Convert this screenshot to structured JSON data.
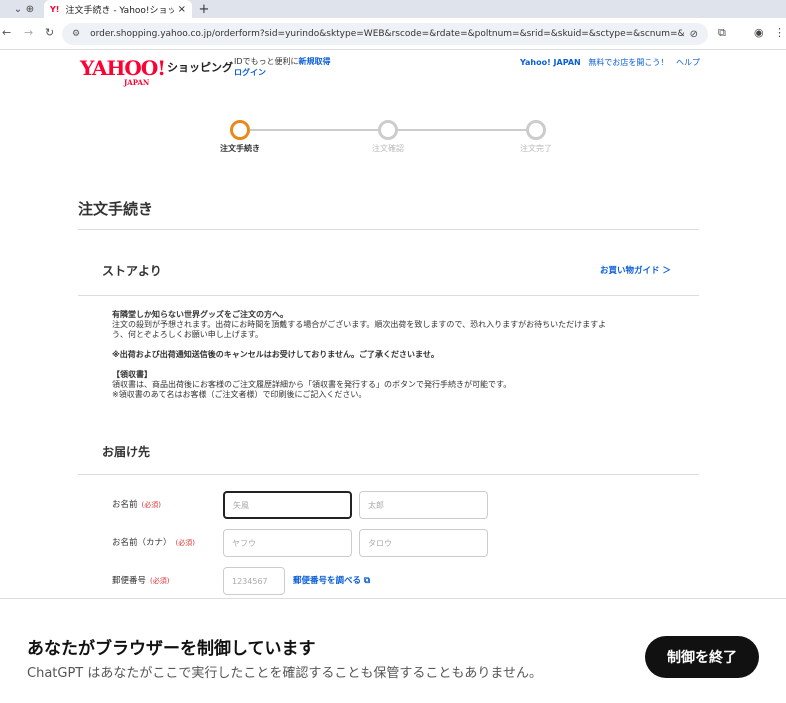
{
  "browser": {
    "pinned_tab_icon": "⊕",
    "active_tab": {
      "favicon": "Y!",
      "title": "注文手続き - Yahoo!ショッピ",
      "close": "×"
    },
    "new_tab": "+",
    "url": "order.shopping.yahoo.co.jp/orderform?sid=yurindo&sktype=WEB&rscode=&rdate=&poltnum=&srid=&skuid=&sctype=&scnum=&did=&sgid..."
  },
  "header": {
    "logo": "YAHOO!",
    "logo_sub": "JAPAN",
    "shopping": "ショッピング",
    "id_text": "IDでもっと便利に",
    "register": "新規取得",
    "login": "ログイン",
    "right_links": {
      "yahoo": "Yahoo! JAPAN",
      "open_store": "無料でお店を開こう！",
      "help": "ヘルプ"
    }
  },
  "steps": [
    {
      "label": "注文手続き",
      "active": true
    },
    {
      "label": "注文確認",
      "active": false
    },
    {
      "label": "注文完了",
      "active": false
    }
  ],
  "page_title": "注文手続き",
  "store_section": {
    "title": "ストアより",
    "guide_link": "お買い物ガイド ＞",
    "notice": {
      "line1": "有隣堂しか知らない世界グッズをご注文の方へ。",
      "line2": "注文の殺到が予想されます。出荷にお時間を頂戴する場合がございます。順次出荷を致しますので、恐れ入りますがお待ちいただけますよ",
      "line3": "う、何とぞよろしくお願い申し上げます。",
      "line4": "※出荷および出荷通知送信後のキャンセルはお受けしておりません。ご了承くださいませ。",
      "line5": "【領収書】",
      "line6": "領収書は、商品出荷後にお客様のご注文履歴詳細から「領収書を発行する」のボタンで発行手続きが可能です。",
      "line7": "※領収書のあて名はお客様（ご注文者様）で印刷後にご記入ください。"
    }
  },
  "delivery": {
    "title": "お届け先",
    "required": "(必須)",
    "name_label": "お名前",
    "name_last_placeholder": "矢風",
    "name_first_placeholder": "太郎",
    "kana_label": "お名前（カナ）",
    "kana_last_placeholder": "ヤフウ",
    "kana_first_placeholder": "タロウ",
    "zip_label": "郵便番号",
    "zip_placeholder": "1234567",
    "zip_lookup": "郵便番号を調べる ⧉"
  },
  "banner": {
    "title": "あなたがブラウザーを制御しています",
    "subtitle": "ChatGPT はあなたがここで実行したことを確認することも保管することもありません。",
    "stop_button": "制御を終了"
  }
}
